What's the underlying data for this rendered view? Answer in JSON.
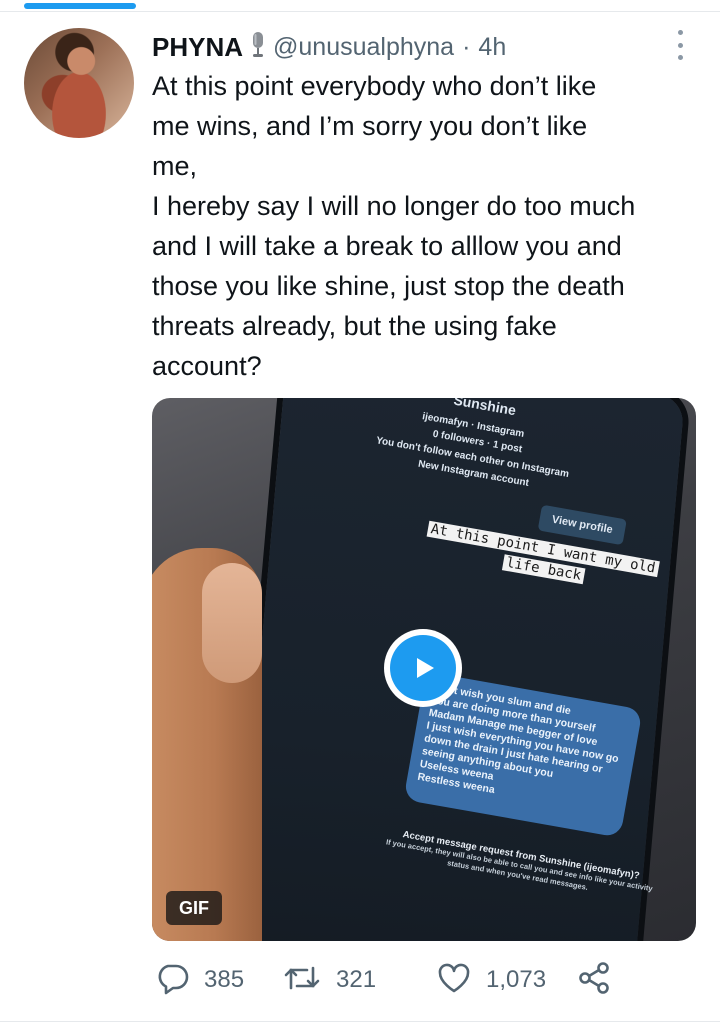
{
  "tweet": {
    "display_name": "PHYNA",
    "name_emoji": "microphone-icon",
    "handle": "@unusualphyna",
    "separator": "·",
    "time": "4h",
    "text_lines": [
      "At this point everybody who don’t like",
      "me wins, and I’m sorry you don’t like",
      "me,",
      "I hereby say I will no longer do too much",
      "and I will take a break to alllow you and",
      "those you like shine, just stop the death",
      "threats already, but the using fake",
      "account?"
    ]
  },
  "media": {
    "type": "GIF",
    "badge_label": "GIF",
    "screen": {
      "profile_name": "Sunshine",
      "profile_sub": "ijeomafyn · Instagram",
      "profile_stats": "0 followers · 1 post",
      "follow_note": "You don't follow each other on Instagram",
      "account_note": "New Instagram account",
      "view_profile_label": "View profile",
      "highlight_line1": "At this point I want my old",
      "highlight_line2": "life back",
      "message_lines": [
        "I just wish you slum and die",
        "You are doing more than yourself",
        "Madam Manage me begger of love",
        "I just wish everything you have now go",
        "down the drain I just hate hearing or",
        "seeing anything about you",
        "Useless weena",
        "Restless weena"
      ],
      "accept_title": "Accept message request from Sunshine (ijeomafyn)?",
      "accept_sub1": "If you accept, they will also be able to call you and see info like your activity",
      "accept_sub2": "status and when you've read messages."
    }
  },
  "actions": {
    "replies": "385",
    "retweets": "321",
    "likes": "1,073"
  },
  "colors": {
    "accent": "#1d9bf0",
    "secondary_text": "#536471",
    "icon": "#536471"
  }
}
